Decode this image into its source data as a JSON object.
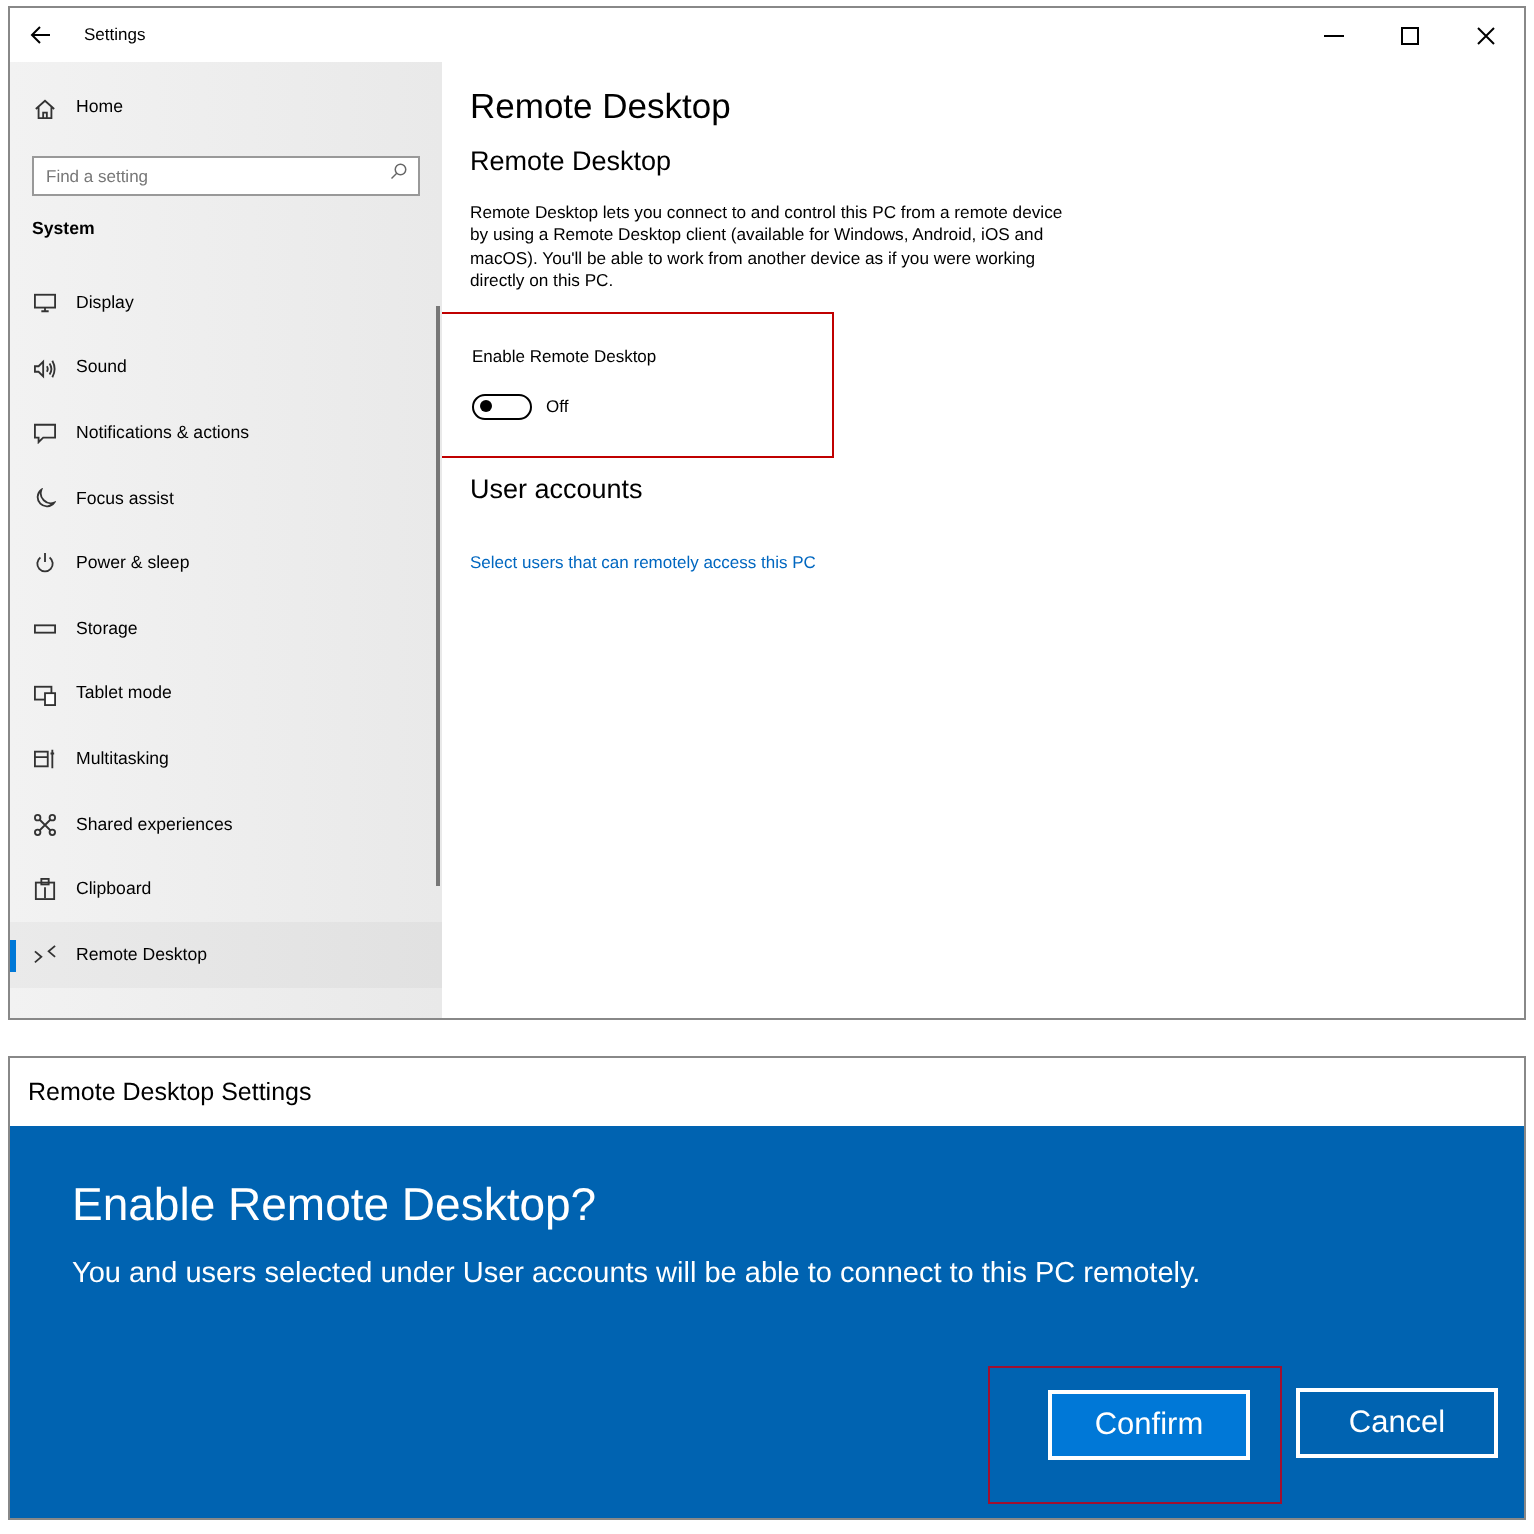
{
  "settings_window": {
    "title": "Settings",
    "sidebar": {
      "home": "Home",
      "search": {
        "placeholder": "Find a setting"
      },
      "section": "System",
      "items": [
        {
          "label": "Display",
          "selected": false
        },
        {
          "label": "Sound",
          "selected": false
        },
        {
          "label": "Notifications & actions",
          "selected": false
        },
        {
          "label": "Focus assist",
          "selected": false
        },
        {
          "label": "Power & sleep",
          "selected": false
        },
        {
          "label": "Storage",
          "selected": false
        },
        {
          "label": "Tablet mode",
          "selected": false
        },
        {
          "label": "Multitasking",
          "selected": false
        },
        {
          "label": "Shared experiences",
          "selected": false
        },
        {
          "label": "Clipboard",
          "selected": false
        },
        {
          "label": "Remote Desktop",
          "selected": true
        }
      ]
    },
    "content": {
      "title": "Remote Desktop",
      "section": "Remote Desktop",
      "description": "Remote Desktop lets you connect to and control this PC from a remote device by using a Remote Desktop client (available for Windows, Android, iOS and macOS). You'll be able to work from another device as if you were working directly on this PC.",
      "toggle": {
        "label": "Enable Remote Desktop",
        "on": false,
        "state_text": "Off",
        "highlighted": true
      },
      "user_accounts": {
        "heading": "User accounts",
        "link": "Select users that can remotely access this PC"
      }
    }
  },
  "dialog": {
    "title": "Remote Desktop Settings",
    "heading": "Enable Remote Desktop?",
    "message": "You and users selected under User accounts will be able to connect to this PC remotely.",
    "buttons": [
      {
        "label": "Confirm",
        "default": true,
        "highlighted": true
      },
      {
        "label": "Cancel",
        "default": false,
        "highlighted": false
      }
    ]
  }
}
